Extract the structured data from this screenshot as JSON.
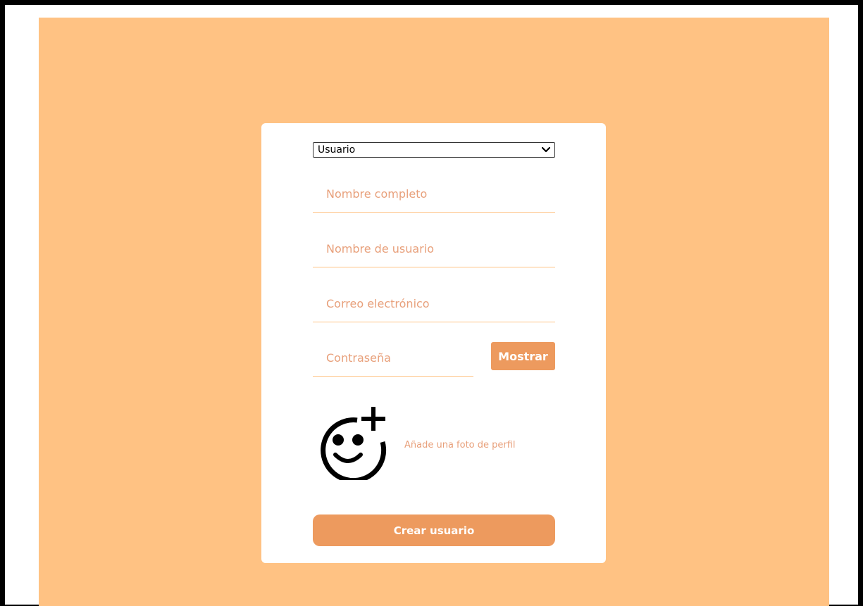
{
  "form": {
    "role_select": {
      "selected": "Usuario"
    },
    "fields": {
      "full_name_placeholder": "Nombre completo",
      "username_placeholder": "Nombre de usuario",
      "email_placeholder": "Correo electrónico",
      "password_placeholder": "Contraseña"
    },
    "show_password_label": "Mostrar",
    "photo_label": "Añade una foto de perfil",
    "submit_label": "Crear usuario"
  },
  "colors": {
    "page_background": "#ffc283",
    "card_background": "#ffffff",
    "accent": "#ed9a5e",
    "placeholder_text": "#e8a07b"
  },
  "icons": {
    "add_photo": "add-reaction-icon",
    "dropdown": "chevron-down-icon"
  }
}
